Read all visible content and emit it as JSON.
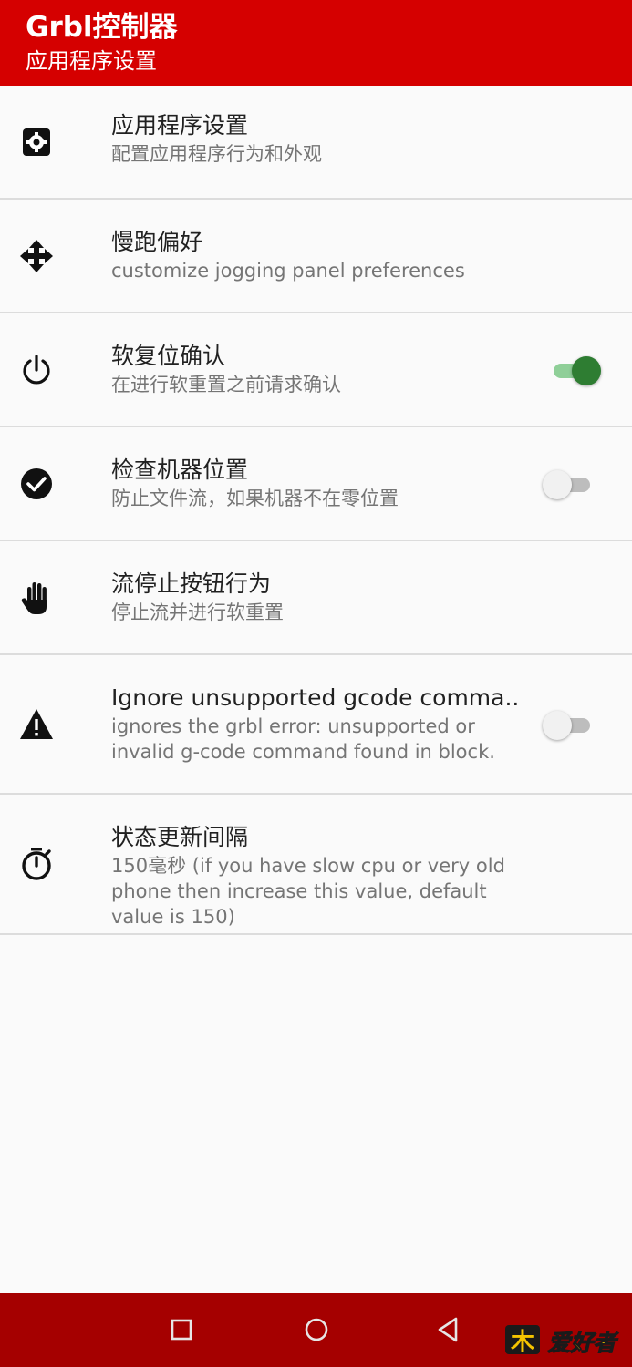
{
  "appbar": {
    "title": "Grbl控制器",
    "subtitle": "应用程序设置"
  },
  "colors": {
    "appbar_bg": "#d50000",
    "navbar_bg": "#a50000",
    "switch_on": "#2e7d32"
  },
  "settings": [
    {
      "icon": "gear-icon",
      "label": "应用程序设置",
      "summary": "配置应用程序行为和外观"
    },
    {
      "icon": "move-arrows-icon",
      "label": "慢跑偏好",
      "summary": "customize jogging panel preferences"
    },
    {
      "icon": "power-icon",
      "label": "软复位确认",
      "summary": "在进行软重置之前请求确认",
      "switch": true
    },
    {
      "icon": "check-circle-icon",
      "label": "检查机器位置",
      "summary": "防止文件流，如果机器不在零位置",
      "switch": false
    },
    {
      "icon": "hand-stop-icon",
      "label": "流停止按钮行为",
      "summary": "停止流并进行软重置"
    },
    {
      "icon": "warning-icon",
      "label": "Ignore unsupported gcode comma..",
      "summary": "ignores the grbl error: unsupported or invalid g-code command found in block.",
      "switch": false
    },
    {
      "icon": "stopwatch-icon",
      "label": "状态更新间隔",
      "summary": "150毫秒 (if you have slow cpu or very old phone then increase this value, default value is 150)"
    }
  ],
  "navbar": {
    "buttons": [
      "recent-apps-icon",
      "home-icon",
      "back-icon"
    ]
  },
  "watermark": {
    "text": "爱好者"
  }
}
